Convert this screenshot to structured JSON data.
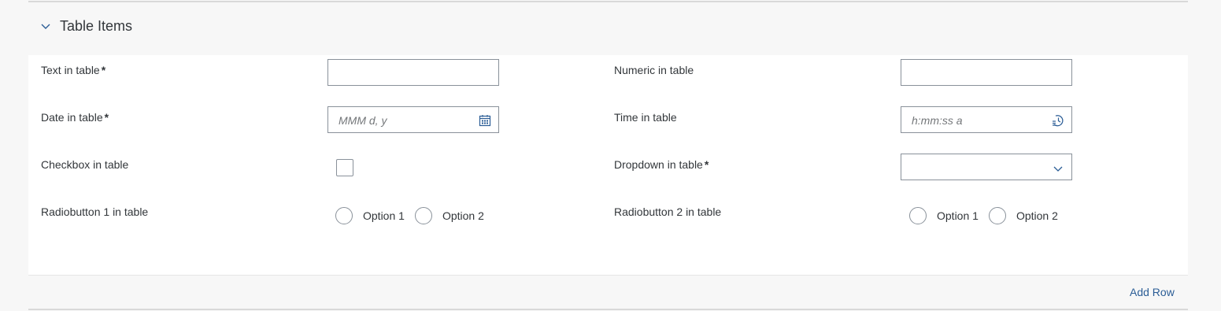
{
  "section": {
    "title": "Table Items"
  },
  "fields": {
    "text_label": "Text in table",
    "text_value": "",
    "numeric_label": "Numeric in table",
    "numeric_value": "",
    "date_label": "Date in table",
    "date_placeholder": "MMM d, y",
    "time_label": "Time in table",
    "time_placeholder": "h:mm:ss a",
    "checkbox_label": "Checkbox in table",
    "checkbox_checked": false,
    "dropdown_label": "Dropdown in table",
    "dropdown_value": "",
    "radio1_label": "Radiobutton 1 in table",
    "radio2_label": "Radiobutton 2 in table",
    "option1": "Option 1",
    "option2": "Option 2",
    "required_marker": "*"
  },
  "footer": {
    "add_row_label": "Add Row"
  },
  "colors": {
    "accent": "#2b5d96",
    "border": "#89919a",
    "text": "#32363a"
  },
  "icons": [
    "chevron-down-icon",
    "calendar-icon",
    "time-icon",
    "dropdown-chevron-icon"
  ]
}
